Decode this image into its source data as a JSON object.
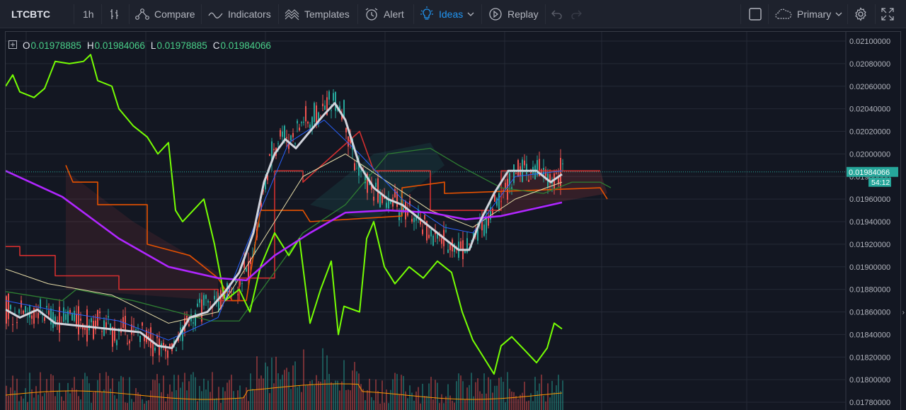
{
  "toolbar": {
    "symbol": "LTCBTC",
    "interval": "1h",
    "compare_label": "Compare",
    "indicators_label": "Indicators",
    "templates_label": "Templates",
    "alert_label": "Alert",
    "ideas_label": "Ideas",
    "replay_label": "Replay",
    "layout_label": "Primary"
  },
  "ohlc": {
    "o_label": "O",
    "o_value": "0.01978885",
    "h_label": "H",
    "h_value": "0.01984066",
    "l_label": "L",
    "l_value": "0.01978885",
    "c_label": "C",
    "c_value": "0.01984066"
  },
  "icons": [
    "bar-style-icon",
    "compare-icon",
    "indicators-icon",
    "templates-icon",
    "alert-icon",
    "lightbulb-icon",
    "replay-icon",
    "undo-icon",
    "redo-icon",
    "square-icon",
    "cloud-icon",
    "gear-icon",
    "fullscreen-icon"
  ],
  "colors": {
    "background": "#131722",
    "up": "#26a69a",
    "down": "#ef5350",
    "lagging_span": "#76ff03",
    "ma_long": "#b026ff",
    "ma_fast": "#e0e0e0",
    "ichimoku_red": "#d32f2f",
    "ichimoku_orange": "#e65100",
    "ichimoku_green": "#2e7d32",
    "price_label": "#26a69a"
  },
  "chart_data": {
    "type": "candlestick",
    "symbol": "LTCBTC",
    "timeframe": "1h",
    "ylim": [
      0.01775,
      0.02105
    ],
    "y_ticks": [
      "0.02100000",
      "0.02080000",
      "0.02060000",
      "0.02040000",
      "0.02020000",
      "0.02000000",
      "0.01980000",
      "0.01960000",
      "0.01940000",
      "0.01920000",
      "0.01900000",
      "0.01880000",
      "0.01860000",
      "0.01840000",
      "0.01820000",
      "0.01800000",
      "0.01780000"
    ],
    "last_price": 0.01984066,
    "last_price_label": "0.01984066",
    "countdown": "54:12",
    "price_path": [
      [
        0,
        0.01862
      ],
      [
        12,
        0.01858
      ],
      [
        25,
        0.01865
      ],
      [
        40,
        0.01855
      ],
      [
        55,
        0.0186
      ],
      [
        70,
        0.01852
      ],
      [
        90,
        0.01858
      ],
      [
        110,
        0.01848
      ],
      [
        130,
        0.0185
      ],
      [
        150,
        0.01842
      ],
      [
        170,
        0.01846
      ],
      [
        190,
        0.0184
      ],
      [
        210,
        0.01835
      ],
      [
        225,
        0.01825
      ],
      [
        240,
        0.0183
      ],
      [
        255,
        0.0185
      ],
      [
        270,
        0.01862
      ],
      [
        285,
        0.01866
      ],
      [
        300,
        0.0187
      ],
      [
        315,
        0.01878
      ],
      [
        325,
        0.01885
      ],
      [
        335,
        0.0189
      ],
      [
        345,
        0.01905
      ],
      [
        355,
        0.0193
      ],
      [
        362,
        0.0196
      ],
      [
        370,
        0.01985
      ],
      [
        380,
        0.0201
      ],
      [
        390,
        0.0202
      ],
      [
        400,
        0.02013
      ],
      [
        410,
        0.0202
      ],
      [
        420,
        0.0203
      ],
      [
        430,
        0.02025
      ],
      [
        440,
        0.02035
      ],
      [
        450,
        0.02042
      ],
      [
        460,
        0.02048
      ],
      [
        470,
        0.02045
      ],
      [
        478,
        0.02035
      ],
      [
        485,
        0.02015
      ],
      [
        492,
        0.01995
      ],
      [
        500,
        0.01985
      ],
      [
        510,
        0.01975
      ],
      [
        520,
        0.01968
      ],
      [
        530,
        0.01962
      ],
      [
        540,
        0.01955
      ],
      [
        550,
        0.0196
      ],
      [
        560,
        0.0195
      ],
      [
        570,
        0.01945
      ],
      [
        580,
        0.0194
      ],
      [
        590,
        0.01935
      ],
      [
        600,
        0.0193
      ],
      [
        610,
        0.01925
      ],
      [
        620,
        0.01922
      ],
      [
        630,
        0.0192
      ],
      [
        640,
        0.01918
      ],
      [
        650,
        0.01918
      ],
      [
        660,
        0.01925
      ],
      [
        670,
        0.01935
      ],
      [
        680,
        0.01945
      ],
      [
        690,
        0.01955
      ],
      [
        700,
        0.01965
      ],
      [
        710,
        0.01975
      ],
      [
        720,
        0.01985
      ],
      [
        730,
        0.01988
      ],
      [
        740,
        0.01982
      ],
      [
        750,
        0.01986
      ],
      [
        760,
        0.0198
      ],
      [
        770,
        0.01978
      ],
      [
        780,
        0.01982
      ],
      [
        786,
        0.01984
      ]
    ],
    "volume_y": [
      0.0178,
      0.0182
    ]
  }
}
